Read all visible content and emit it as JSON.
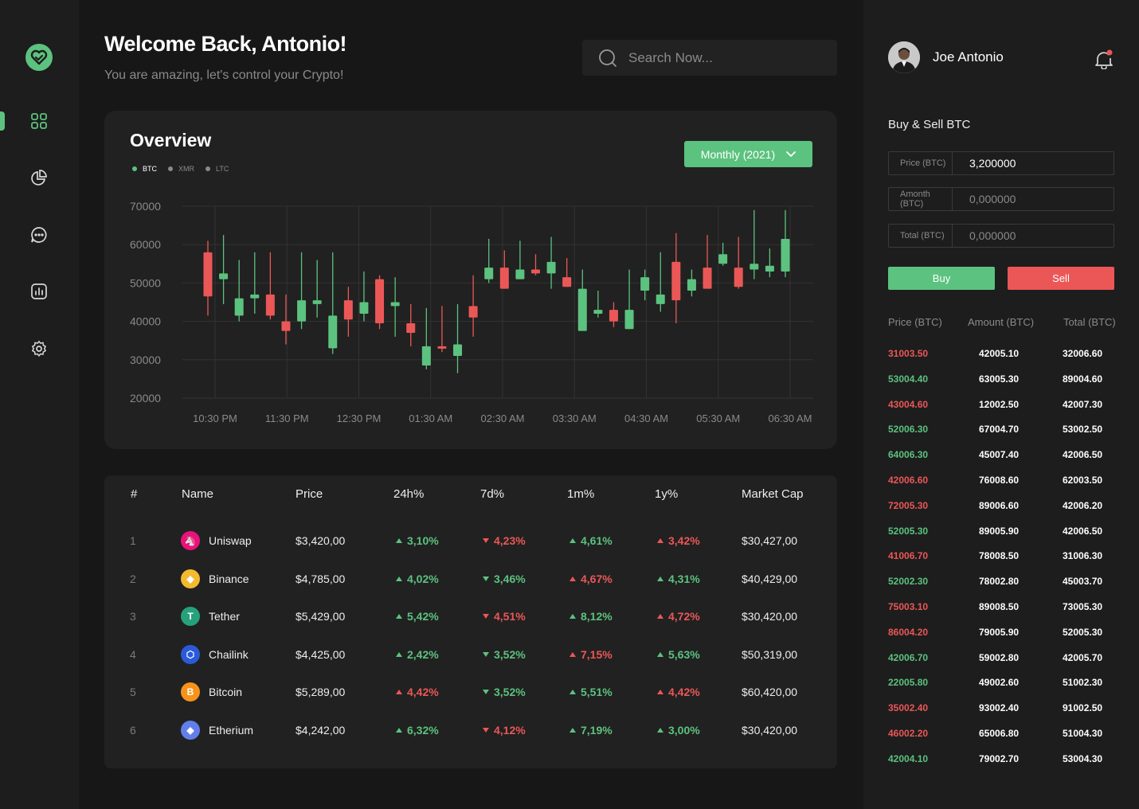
{
  "header": {
    "welcome": "Welcome Back, Antonio!",
    "subtitle": "You are amazing, let's control your Crypto!",
    "search_placeholder": "Search Now..."
  },
  "sidebar": {
    "items": [
      {
        "icon": "dashboard-icon",
        "active": true
      },
      {
        "icon": "pie-chart-icon",
        "active": false
      },
      {
        "icon": "chat-icon",
        "active": false
      },
      {
        "icon": "bar-chart-icon",
        "active": false
      },
      {
        "icon": "settings-icon",
        "active": false
      }
    ]
  },
  "overview": {
    "title": "Overview",
    "legend": [
      "BTC",
      "XMR",
      "LTC"
    ],
    "period_label": "Monthly (2021)"
  },
  "chart_data": {
    "type": "candlestick",
    "ylim": [
      20000,
      70000
    ],
    "yticks": [
      "70000",
      "60000",
      "50000",
      "40000",
      "30000",
      "20000"
    ],
    "xticks": [
      "10:30 PM",
      "11:30 PM",
      "12:30 PM",
      "01:30 AM",
      "02:30 AM",
      "03:30 AM",
      "04:30 AM",
      "05:30 AM",
      "06:30 AM"
    ],
    "candles": [
      {
        "o": 58000,
        "c": 46500,
        "h": 61000,
        "l": 41500
      },
      {
        "o": 51000,
        "c": 52500,
        "h": 62500,
        "l": 44500
      },
      {
        "o": 41500,
        "c": 46000,
        "h": 56000,
        "l": 40000
      },
      {
        "o": 46000,
        "c": 47000,
        "h": 58000,
        "l": 42000
      },
      {
        "o": 47000,
        "c": 41500,
        "h": 58000,
        "l": 40500
      },
      {
        "o": 40000,
        "c": 37500,
        "h": 47000,
        "l": 34000
      },
      {
        "o": 40000,
        "c": 45500,
        "h": 58000,
        "l": 38000
      },
      {
        "o": 44500,
        "c": 45500,
        "h": 56000,
        "l": 41000
      },
      {
        "o": 33000,
        "c": 41500,
        "h": 58000,
        "l": 31500
      },
      {
        "o": 45500,
        "c": 40500,
        "h": 49000,
        "l": 36000
      },
      {
        "o": 42000,
        "c": 45000,
        "h": 53000,
        "l": 40000
      },
      {
        "o": 51000,
        "c": 39500,
        "h": 52000,
        "l": 38000
      },
      {
        "o": 44000,
        "c": 45000,
        "h": 51500,
        "l": 36000
      },
      {
        "o": 39500,
        "c": 37000,
        "h": 44500,
        "l": 33500
      },
      {
        "o": 28500,
        "c": 33500,
        "h": 43500,
        "l": 27500
      },
      {
        "o": 33500,
        "c": 33000,
        "h": 44000,
        "l": 32000
      },
      {
        "o": 31000,
        "c": 34000,
        "h": 44500,
        "l": 26500
      },
      {
        "o": 44000,
        "c": 41000,
        "h": 52000,
        "l": 36000
      },
      {
        "o": 51000,
        "c": 54000,
        "h": 61500,
        "l": 50000
      },
      {
        "o": 54000,
        "c": 48500,
        "h": 58500,
        "l": 48500
      },
      {
        "o": 51000,
        "c": 53500,
        "h": 61000,
        "l": 51000
      },
      {
        "o": 53500,
        "c": 52500,
        "h": 57500,
        "l": 52000
      },
      {
        "o": 52500,
        "c": 55500,
        "h": 62000,
        "l": 48500
      },
      {
        "o": 51500,
        "c": 49000,
        "h": 56500,
        "l": 49000
      },
      {
        "o": 37500,
        "c": 48500,
        "h": 53500,
        "l": 37500
      },
      {
        "o": 42000,
        "c": 43000,
        "h": 48000,
        "l": 41000
      },
      {
        "o": 43000,
        "c": 40000,
        "h": 45000,
        "l": 38500
      },
      {
        "o": 38000,
        "c": 43000,
        "h": 53500,
        "l": 38000
      },
      {
        "o": 48000,
        "c": 51500,
        "h": 53500,
        "l": 45500
      },
      {
        "o": 44500,
        "c": 47000,
        "h": 58000,
        "l": 42500
      },
      {
        "o": 55500,
        "c": 45500,
        "h": 63000,
        "l": 39500
      },
      {
        "o": 48000,
        "c": 51000,
        "h": 53500,
        "l": 46500
      },
      {
        "o": 54000,
        "c": 48500,
        "h": 62500,
        "l": 48500
      },
      {
        "o": 55000,
        "c": 57500,
        "h": 60500,
        "l": 54500
      },
      {
        "o": 54000,
        "c": 49000,
        "h": 62000,
        "l": 48500
      },
      {
        "o": 53500,
        "c": 55000,
        "h": 69000,
        "l": 51000
      },
      {
        "o": 53000,
        "c": 54500,
        "h": 59000,
        "l": 51500
      },
      {
        "o": 53000,
        "c": 61500,
        "h": 69000,
        "l": 51500
      }
    ]
  },
  "table": {
    "headers": [
      "#",
      "Name",
      "Price",
      "24h%",
      "7d%",
      "1m%",
      "1y%",
      "Market Cap"
    ],
    "rows": [
      {
        "num": "1",
        "name": "Uniswap",
        "icon": "uniswap-icon",
        "color": "#e8127a",
        "price": "$3,420,00",
        "h24": "3,10%",
        "h24_dir": "up",
        "d7": "4,23%",
        "d7_dir": "down",
        "m1": "4,61%",
        "m1_dir": "up",
        "y1": "3,42%",
        "y1_dir": "up_red",
        "cap": "$30,427,00"
      },
      {
        "num": "2",
        "name": "Binance",
        "icon": "binance-icon",
        "color": "#f3ba2f",
        "price": "$4,785,00",
        "h24": "4,02%",
        "h24_dir": "up",
        "d7": "3,46%",
        "d7_dir": "down_green",
        "m1": "4,67%",
        "m1_dir": "up_red",
        "y1": "4,31%",
        "y1_dir": "up",
        "cap": "$40,429,00"
      },
      {
        "num": "3",
        "name": "Tether",
        "icon": "tether-icon",
        "color": "#26a17b",
        "price": "$5,429,00",
        "h24": "5,42%",
        "h24_dir": "up",
        "d7": "4,51%",
        "d7_dir": "down",
        "m1": "8,12%",
        "m1_dir": "up",
        "y1": "4,72%",
        "y1_dir": "up_red",
        "cap": "$30,420,00"
      },
      {
        "num": "4",
        "name": "Chailink",
        "icon": "chainlink-icon",
        "color": "#2a5ada",
        "price": "$4,425,00",
        "h24": "2,42%",
        "h24_dir": "up",
        "d7": "3,52%",
        "d7_dir": "down_green",
        "m1": "7,15%",
        "m1_dir": "up_red",
        "y1": "5,63%",
        "y1_dir": "up",
        "cap": "$50,319,00"
      },
      {
        "num": "5",
        "name": "Bitcoin",
        "icon": "bitcoin-icon",
        "color": "#f7931a",
        "price": "$5,289,00",
        "h24": "4,42%",
        "h24_dir": "up_red",
        "d7": "3,52%",
        "d7_dir": "down_green",
        "m1": "5,51%",
        "m1_dir": "up",
        "y1": "4,42%",
        "y1_dir": "up_red",
        "cap": "$60,420,00"
      },
      {
        "num": "6",
        "name": "Etherium",
        "icon": "ethereum-icon",
        "color": "#627eea",
        "price": "$4,242,00",
        "h24": "6,32%",
        "h24_dir": "up",
        "d7": "4,12%",
        "d7_dir": "down",
        "m1": "7,19%",
        "m1_dir": "up",
        "y1": "3,00%",
        "y1_dir": "up",
        "cap": "$30,420,00"
      }
    ]
  },
  "user": {
    "name": "Joe Antonio"
  },
  "trade": {
    "title": "Buy & Sell BTC",
    "fields": [
      {
        "label": "Price (BTC)",
        "value": "3,200000"
      },
      {
        "label": "Amonth (BTC)",
        "value": "0,000000"
      },
      {
        "label": "Total (BTC)",
        "value": "0,000000"
      }
    ],
    "buy_label": "Buy",
    "sell_label": "Sell"
  },
  "orderbook": {
    "headers": [
      "Price (BTC)",
      "Amount (BTC)",
      "Total (BTC)"
    ],
    "rows": [
      {
        "price": "31003.50",
        "amount": "42005.10",
        "total": "32006.60",
        "side": "sell"
      },
      {
        "price": "53004.40",
        "amount": "63005.30",
        "total": "89004.60",
        "side": "buy"
      },
      {
        "price": "43004.60",
        "amount": "12002.50",
        "total": "42007.30",
        "side": "sell"
      },
      {
        "price": "52006.30",
        "amount": "67004.70",
        "total": "53002.50",
        "side": "buy"
      },
      {
        "price": "64006.30",
        "amount": "45007.40",
        "total": "42006.50",
        "side": "buy"
      },
      {
        "price": "42006.60",
        "amount": "76008.60",
        "total": "62003.50",
        "side": "sell"
      },
      {
        "price": "72005.30",
        "amount": "89006.60",
        "total": "42006.20",
        "side": "sell"
      },
      {
        "price": "52005.30",
        "amount": "89005.90",
        "total": "42006.50",
        "side": "buy"
      },
      {
        "price": "41006.70",
        "amount": "78008.50",
        "total": "31006.30",
        "side": "sell"
      },
      {
        "price": "52002.30",
        "amount": "78002.80",
        "total": "45003.70",
        "side": "buy"
      },
      {
        "price": "75003.10",
        "amount": "89008.50",
        "total": "73005.30",
        "side": "sell"
      },
      {
        "price": "86004.20",
        "amount": "79005.90",
        "total": "52005.30",
        "side": "sell"
      },
      {
        "price": "42006.70",
        "amount": "59002.80",
        "total": "42005.70",
        "side": "buy"
      },
      {
        "price": "22005.80",
        "amount": "49002.60",
        "total": "51002.30",
        "side": "buy"
      },
      {
        "price": "35002.40",
        "amount": "93002.40",
        "total": "91002.50",
        "side": "sell"
      },
      {
        "price": "46002.20",
        "amount": "65006.80",
        "total": "51004.30",
        "side": "sell"
      },
      {
        "price": "42004.10",
        "amount": "79002.70",
        "total": "53004.30",
        "side": "buy"
      }
    ]
  },
  "colors": {
    "green": "#5cc27f",
    "red": "#eb5757",
    "bg": "#171717",
    "card": "#212121"
  }
}
